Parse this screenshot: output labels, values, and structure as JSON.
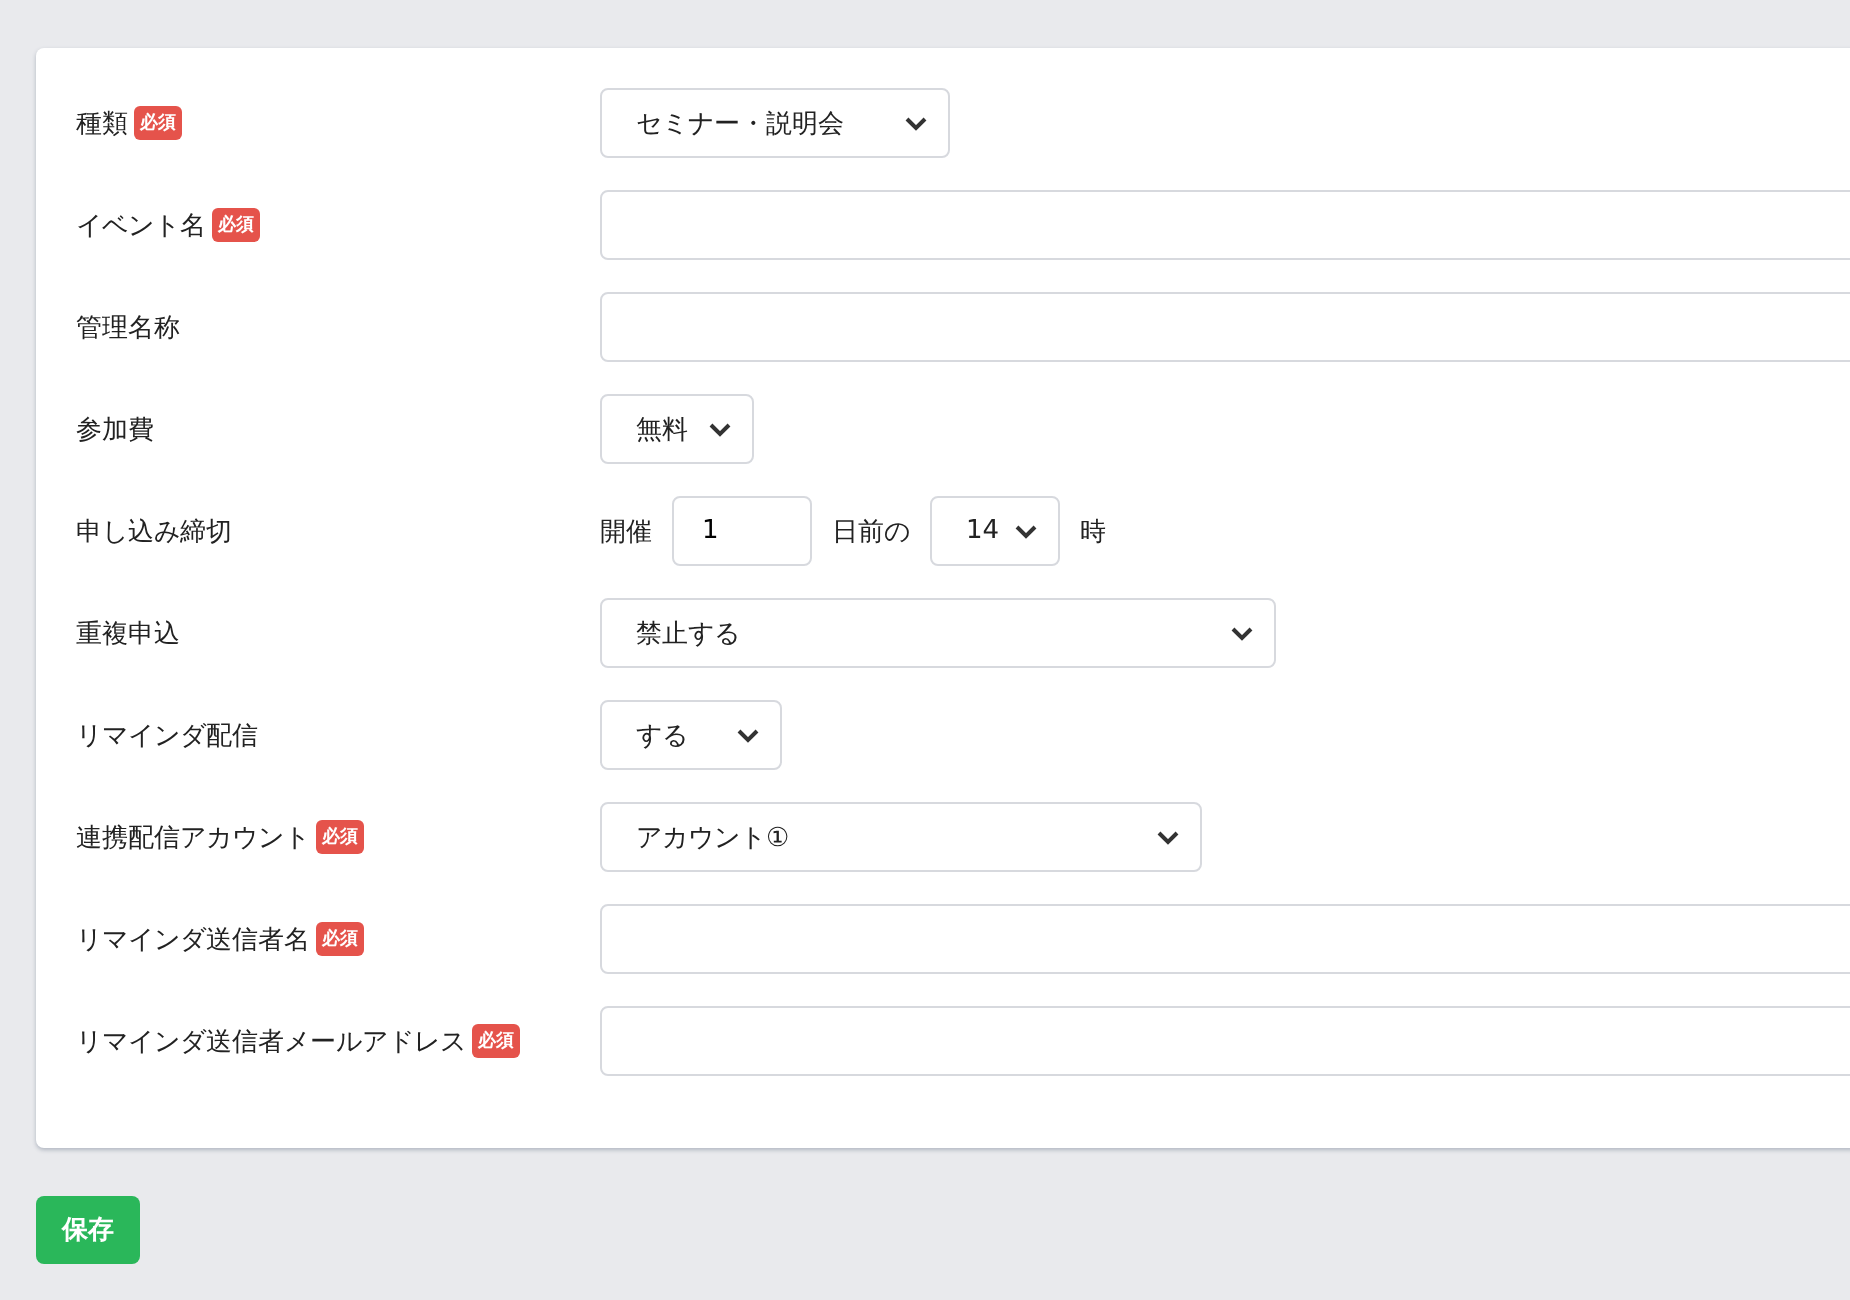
{
  "form": {
    "rows": [
      {
        "label": "種類",
        "badge": "必須",
        "kind": "select",
        "value": "セミナー・説明会"
      },
      {
        "label": "イベント名",
        "badge": "必須",
        "kind": "text"
      },
      {
        "label": "管理名称",
        "kind": "text"
      },
      {
        "label": "参加費",
        "kind": "select",
        "value": "無料"
      },
      {
        "label": "申し込み締切",
        "kind": "deadline",
        "prefix": "開催",
        "days": "1",
        "middle": "日前の",
        "hour": "14",
        "suffix": "時"
      },
      {
        "label": "重複申込",
        "kind": "select",
        "value": "禁止する"
      },
      {
        "label": "リマインダ配信",
        "kind": "select",
        "value": "する"
      },
      {
        "label": "連携配信アカウント",
        "badge": "必須",
        "kind": "select",
        "value": "アカウント①"
      },
      {
        "label": "リマインダ送信者名",
        "badge": "必須",
        "kind": "text"
      },
      {
        "label": "リマインダ送信者メールアドレス",
        "badge": "必須",
        "kind": "text"
      }
    ]
  },
  "save_button": "保存"
}
